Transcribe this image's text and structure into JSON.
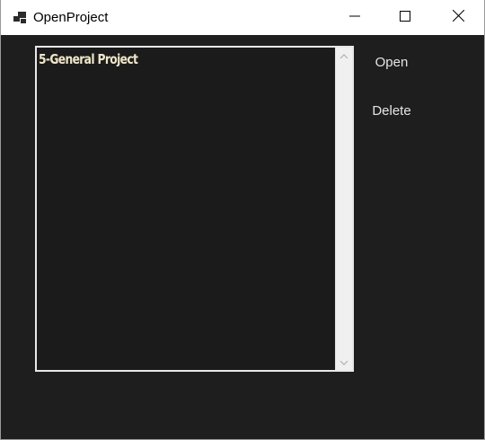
{
  "window": {
    "title": "OpenProject",
    "icons": {
      "app": "window-stack-icon",
      "minimize": "minimize-icon",
      "maximize": "maximize-icon",
      "close": "close-icon"
    }
  },
  "project_list": {
    "items": [
      {
        "label": "5-General Project"
      }
    ],
    "scroll_icons": {
      "up": "chevron-up-icon",
      "down": "chevron-down-icon"
    }
  },
  "actions": {
    "open_label": "Open",
    "delete_label": "Delete"
  },
  "colors": {
    "background": "#1e1e1e",
    "list_background": "#1b1b1b",
    "list_border": "#e8e8e8",
    "item_text": "#f0e6c8",
    "button_text": "#e6e6e6",
    "titlebar": "#ffffff"
  }
}
